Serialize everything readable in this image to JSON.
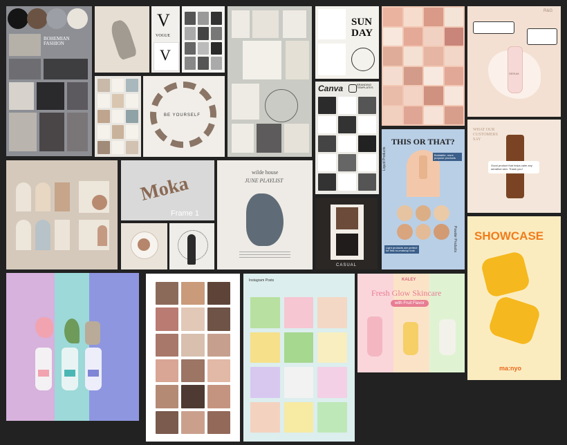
{
  "canvas": {
    "background": "#222222"
  },
  "cards": {
    "fashion": {
      "title": "BOHEMIAN FASHION"
    },
    "vogue": {
      "logo": "VOGUE"
    },
    "yourself": {
      "text": "BE YOURSELF"
    },
    "sunday": {
      "line1": "SUN",
      "line2": "DAY"
    },
    "canva": {
      "logo": "Canva",
      "subtitle": "BRANDING TEMPLATES"
    },
    "review_top": {
      "brand": "R&G",
      "product": "SERUM"
    },
    "customers": {
      "heading": "WHAT OUR CUSTOMERS SAY",
      "quote": "Good product that helps calm any sensitive skin. Thank you!"
    },
    "moka": {
      "logo": "Moka",
      "frame_label": "Frame 1"
    },
    "playlist": {
      "title": "wilde house",
      "subtitle": "JUNE PLAYLIST"
    },
    "casual": {
      "text": "CASUAL"
    },
    "this_or_that": {
      "title": "THIS OR THAT?",
      "side_left": "Liquid Products",
      "side_right": "Powder Products",
      "tag_top": "Buildable, more purpose products",
      "tag_bottom": "Light products are perfect for first no-makeup look"
    },
    "showcase": {
      "title": "SHOWCASE",
      "brand": "ma:nyo"
    },
    "fresh_glow": {
      "brand": "KALEY",
      "title": "Fresh Glow Skincare",
      "subtitle": "with Fruit Flavor"
    },
    "instagram": {
      "heading": "Instagram Posts"
    }
  }
}
